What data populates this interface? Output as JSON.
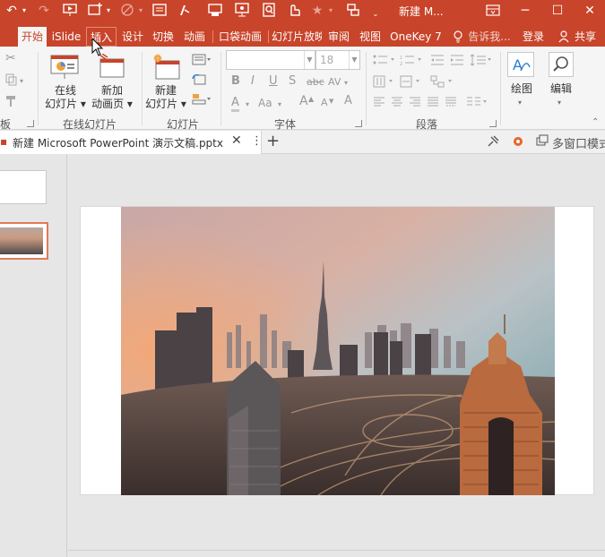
{
  "window": {
    "title": "新建 M...",
    "minimize_glyph": "─",
    "maximize_glyph": "☐",
    "close_glyph": "✕",
    "ribbon_display_icon": "ribbon-display-options-icon"
  },
  "qat": {
    "icons": [
      "undo-icon",
      "redo-icon",
      "start-from-beginning-icon",
      "new-slide-icon",
      "shape-fill-icon",
      "text-box-icon",
      "pen-icon",
      "screen-capture-icon",
      "present-online-icon",
      "find-icon",
      "touch-mode-icon",
      "favorite-star-icon",
      "customize-qat-icon"
    ]
  },
  "tabs": [
    {
      "label": "开始",
      "state": "active"
    },
    {
      "label": "iSlide",
      "state": "normal"
    },
    {
      "label": "插入",
      "state": "hover"
    },
    {
      "label": "设计",
      "state": "normal"
    },
    {
      "label": "切换",
      "state": "normal"
    },
    {
      "label": "动画",
      "state": "normal"
    },
    {
      "label": "口袋动画",
      "state": "normal"
    },
    {
      "label": "幻灯片放映",
      "state": "normal"
    },
    {
      "label": "审阅",
      "state": "normal"
    },
    {
      "label": "视图",
      "state": "normal"
    },
    {
      "label": "OneKey 7",
      "state": "normal"
    },
    {
      "label": "告诉我...",
      "state": "dim"
    },
    {
      "label": "登录",
      "state": "normal"
    },
    {
      "label": "共享",
      "state": "normal"
    }
  ],
  "ribbon": {
    "clipboard": {
      "label": "板"
    },
    "online_slides": {
      "label": "在线幻灯片",
      "btn1_line1": "在线",
      "btn1_line2": "幻灯片 ▾",
      "btn2_line1": "新加",
      "btn2_line2": "动画页 ▾"
    },
    "slides": {
      "label": "幻灯片",
      "new_line1": "新建",
      "new_line2": "幻灯片 ▾"
    },
    "font": {
      "label": "字体",
      "size_value": "18",
      "bold": "B",
      "italic": "I",
      "underline": "U",
      "shadow": "S",
      "strike": "abc",
      "spacing": "AV",
      "color": "A",
      "case": "Aa",
      "grow": "A",
      "shrink": "A",
      "clear": "A"
    },
    "paragraph": {
      "label": "段落"
    },
    "drawing": {
      "label": "绘图"
    },
    "editing": {
      "label": "编辑"
    }
  },
  "document": {
    "tab_name": "新建 Microsoft PowerPoint 演示文稿.pptx",
    "close_glyph": "✕",
    "more_glyph": "⋮",
    "new_tab_glyph": "+",
    "multi_window_label": "多窗口模式"
  },
  "slide": {
    "image_subject": "city-skyline-photo"
  },
  "colors": {
    "accent": "#c8442a",
    "ribbon_bg": "#f5f5f5",
    "workspace_bg": "#e6e6e6",
    "selected_thumb_border": "#e07a5a"
  }
}
